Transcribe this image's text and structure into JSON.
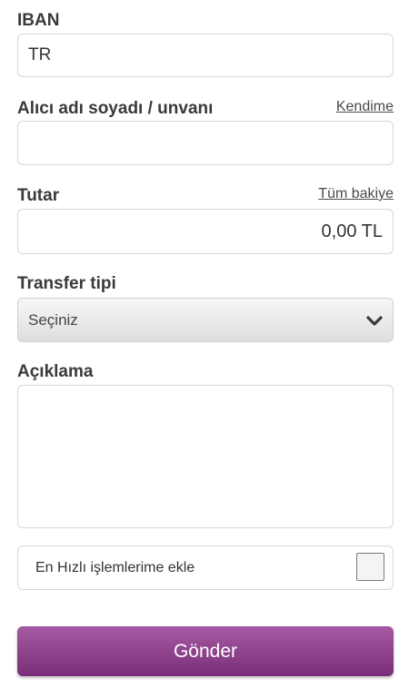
{
  "iban": {
    "label": "IBAN",
    "value": "TR"
  },
  "recipient": {
    "label": "Alıcı adı soyadı / unvanı",
    "link": "Kendime",
    "value": ""
  },
  "amount": {
    "label": "Tutar",
    "link": "Tüm bakiye",
    "value": "0,00 TL"
  },
  "transfer_type": {
    "label": "Transfer tipi",
    "selected": "Seçiniz",
    "icon": "chevron-down-icon"
  },
  "description": {
    "label": "Açıklama",
    "value": ""
  },
  "favorite": {
    "label": "En Hızlı işlemlerime ekle",
    "checked": false
  },
  "submit": {
    "label": "Gönder",
    "color_top": "#a65aa4",
    "color_bottom": "#7a2e78"
  }
}
